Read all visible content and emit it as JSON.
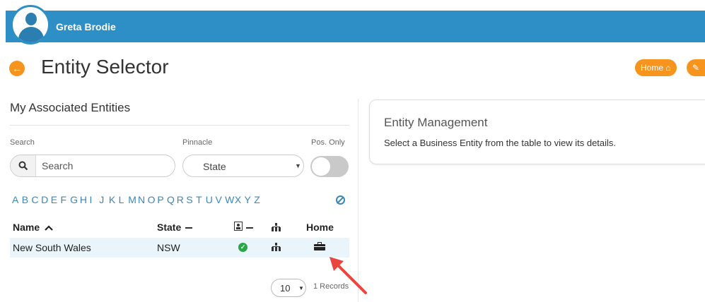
{
  "header": {
    "user_name": "Greta Brodie",
    "avatar_icon": "user-icon",
    "bar_color": "#2d8fc5"
  },
  "page": {
    "title": "Entity Selector",
    "back_icon": "arrow-left-icon",
    "home_label": "Home",
    "home_icon": "home-icon",
    "extra_icon": "tag-icon",
    "accent_color": "#f7941d"
  },
  "associated": {
    "title": "My Associated Entities",
    "search_label": "Search",
    "search_placeholder": "Search",
    "pinnacle_label": "Pinnacle",
    "pinnacle_value": "State",
    "pos_only_label": "Pos. Only",
    "pos_only_on": false,
    "alphabet": [
      "A",
      "B",
      "C",
      "D",
      "E",
      "F",
      "G",
      "H",
      "I",
      "J",
      "K",
      "L",
      "M",
      "N",
      "O",
      "P",
      "Q",
      "R",
      "S",
      "T",
      "U",
      "V",
      "W",
      "X",
      "Y",
      "Z"
    ],
    "clear_filter_icon": "ban-icon"
  },
  "table": {
    "headers": {
      "name": "Name",
      "state": "State",
      "home": "Home"
    },
    "name_sort_icon": "chevron-up-icon",
    "state_sort_icon": "minus-icon",
    "id_card_header_icon": "id-card-icon",
    "hierarchy_header_icon": "sitemap-icon",
    "rows": [
      {
        "name": "New South Wales",
        "state": "NSW",
        "status_icon": "check-circle-icon",
        "hierarchy_icon": "sitemap-icon",
        "home_icon": "briefcase-icon"
      }
    ],
    "page_size": "10",
    "records_text": "1 Records"
  },
  "entity_management": {
    "title": "Entity Management",
    "message": "Select a Business Entity from the table to view its details."
  }
}
